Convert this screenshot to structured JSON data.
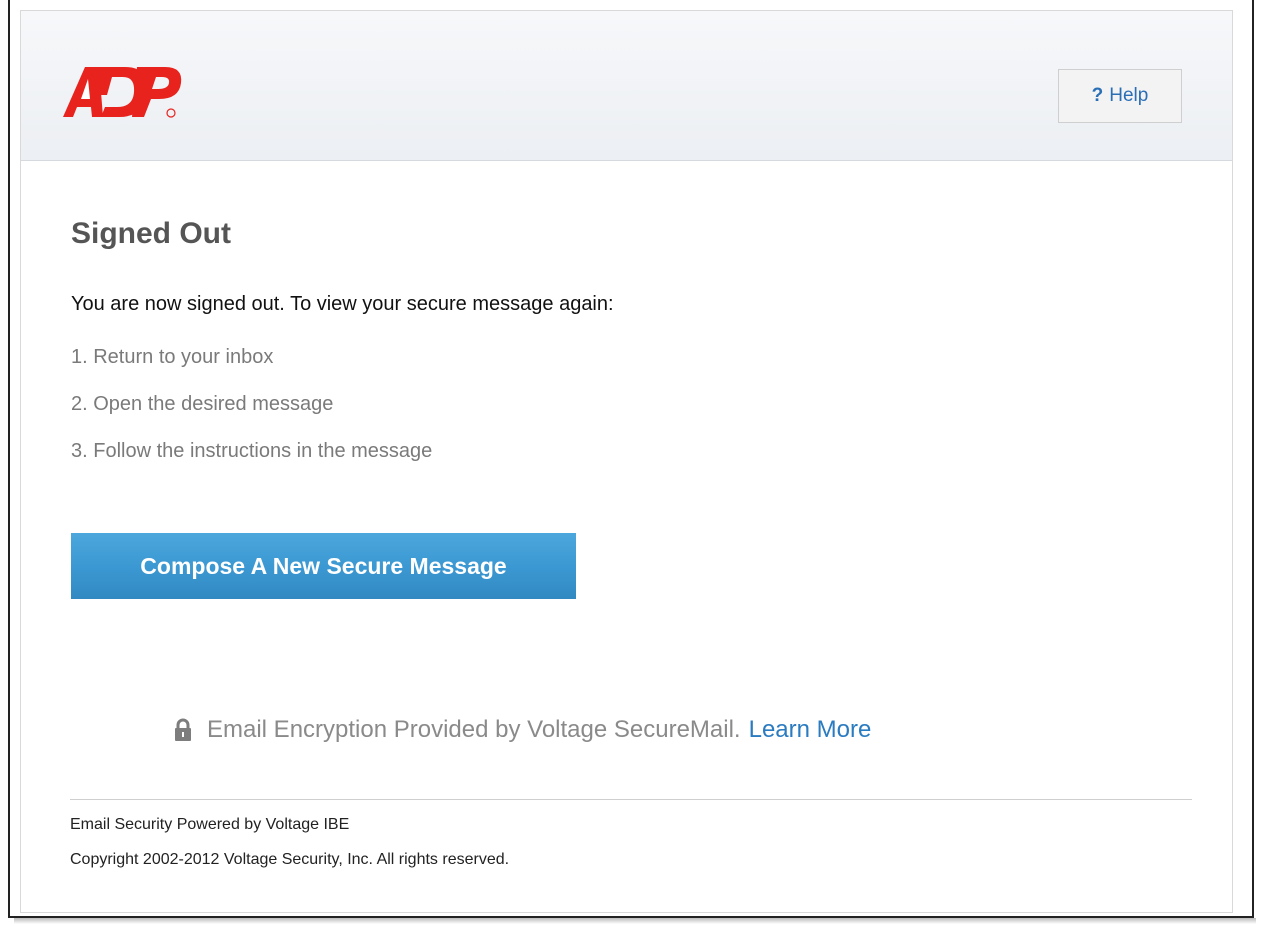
{
  "header": {
    "logo_alt": "ADP",
    "help_label": "Help",
    "help_icon": "?"
  },
  "main": {
    "title": "Signed Out",
    "intro": "You are now signed out. To view your secure message again:",
    "steps": [
      "1.  Return to your inbox",
      "2.  Open the desired message",
      "3.  Follow the instructions in the message"
    ],
    "compose_label": "Compose A New Secure Message"
  },
  "encryption": {
    "text": "Email Encryption Provided by Voltage SecureMail.",
    "link": "Learn More",
    "icon": "lock-icon"
  },
  "footer": {
    "line1": "Email Security Powered by Voltage IBE",
    "line2": "Copyright 2002-2012 Voltage Security, Inc. All rights reserved."
  },
  "colors": {
    "brand_red": "#e8231e",
    "button_blue": "#3b97d1",
    "link_blue": "#2a7bc0"
  }
}
